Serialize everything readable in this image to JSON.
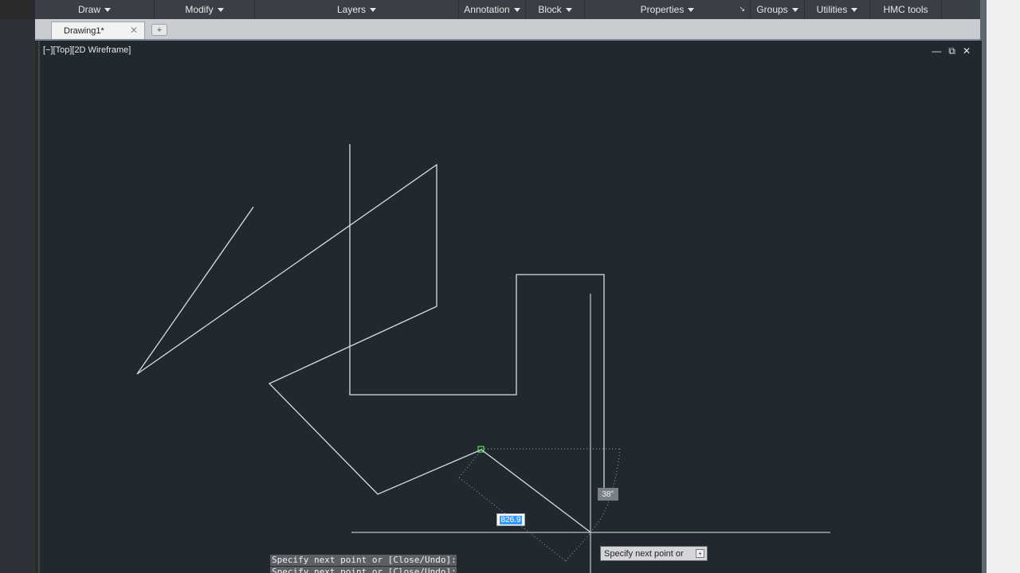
{
  "ribbon": {
    "panels": [
      {
        "label": "Draw"
      },
      {
        "label": "Modify"
      },
      {
        "label": "Layers"
      },
      {
        "label": "Annotation"
      },
      {
        "label": "Block"
      },
      {
        "label": "Properties"
      },
      {
        "label": "Groups"
      },
      {
        "label": "Utilities"
      },
      {
        "label": "HMC tools"
      }
    ]
  },
  "tabs": {
    "active": {
      "label": "Drawing1*",
      "close": "✕"
    },
    "new_tab": "+"
  },
  "viewport": {
    "label": "[−][Top][2D Wireframe]",
    "controls": {
      "minimize": "—",
      "restore": "⧉",
      "close": "✕"
    }
  },
  "dynamic_input": {
    "angle": "38°",
    "distance": "826.9",
    "prompt": "Specify next point or",
    "prompt_button": "+"
  },
  "command_line": {
    "history": [
      "Specify next point or [Close/Undo]:",
      "Specify next point or [Close/Undo]:"
    ]
  },
  "colors": {
    "canvas": "#212830",
    "ribbon": "#3a3f47",
    "geometry": "#d8dde3",
    "osnap": "#66ff66"
  }
}
